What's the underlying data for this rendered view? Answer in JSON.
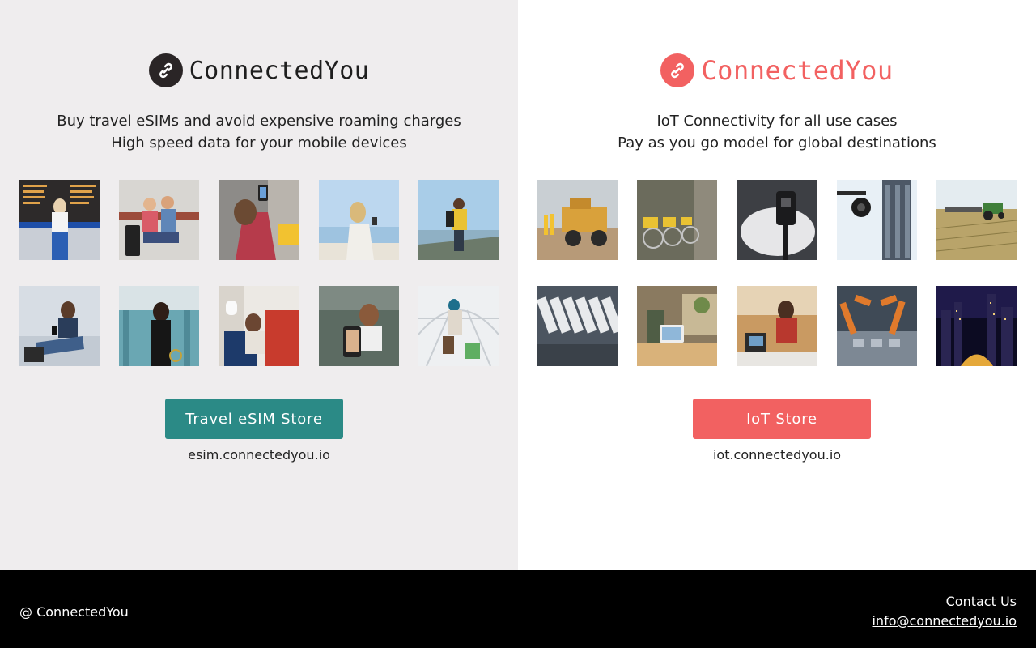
{
  "travel": {
    "brand": "ConnectedYou",
    "tagline_1": "Buy travel eSIMs and avoid expensive roaming charges",
    "tagline_2": "High speed data for your mobile devices",
    "button_label": "Travel eSIM Store",
    "url": "esim.connectedyou.io",
    "accent": "#2b8a86",
    "photos": [
      "airport departures board",
      "couple with luggage",
      "phone photo in city street",
      "woman by the sea with phone",
      "hiker taking photo",
      "woman on phone seated",
      "woman in airport terminal",
      "woman on airplane",
      "friends taking selfie",
      "traveler in glass terminal"
    ]
  },
  "iot": {
    "brand": "ConnectedYou",
    "tagline_1": "IoT Connectivity for all use cases",
    "tagline_2": "Pay as you go model for global destinations",
    "button_label": "IoT Store",
    "url": "iot.connectedyou.io",
    "accent": "#f26161",
    "photos": [
      "mining dump truck",
      "shared e-bikes",
      "EV charger",
      "security camera and tower",
      "tractor in field",
      "fleet of trucks aerial",
      "tablet on sofa",
      "payment terminal",
      "robotic assembly line",
      "city skyline at night"
    ]
  },
  "footer": {
    "copyright": "@ ConnectedYou",
    "contact_label": "Contact Us",
    "email": "info@connectedyou.io"
  }
}
